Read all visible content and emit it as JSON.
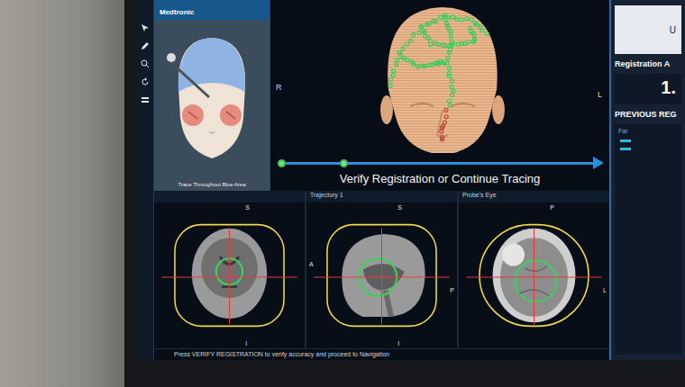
{
  "app": {
    "brand": "Medtronic"
  },
  "guide": {
    "caption": "Trace Throughout Blue Area"
  },
  "head_view": {
    "left_label": "R",
    "right_label": "L"
  },
  "stepper": {
    "steps": [
      {
        "done": true
      },
      {
        "done": true
      }
    ],
    "banner": "Verify Registration or Continue Tracing"
  },
  "views": [
    {
      "title": "",
      "axes": [
        "S",
        "I"
      ]
    },
    {
      "title": "Trajectory 1",
      "axes": [
        "S",
        "I",
        "A",
        "P"
      ]
    },
    {
      "title": "Probe's Eye",
      "axes": [
        "P",
        "",
        "",
        "L"
      ]
    }
  ],
  "instruction": "Press VERIFY REGISTRATION to verify accuracy and proceed to Navigation",
  "right_panel": {
    "header": "U",
    "registration_label": "Registration A",
    "registration_value": "1.",
    "previous_label": "PREVIOUS REG",
    "previous_items": [
      "Far"
    ]
  }
}
